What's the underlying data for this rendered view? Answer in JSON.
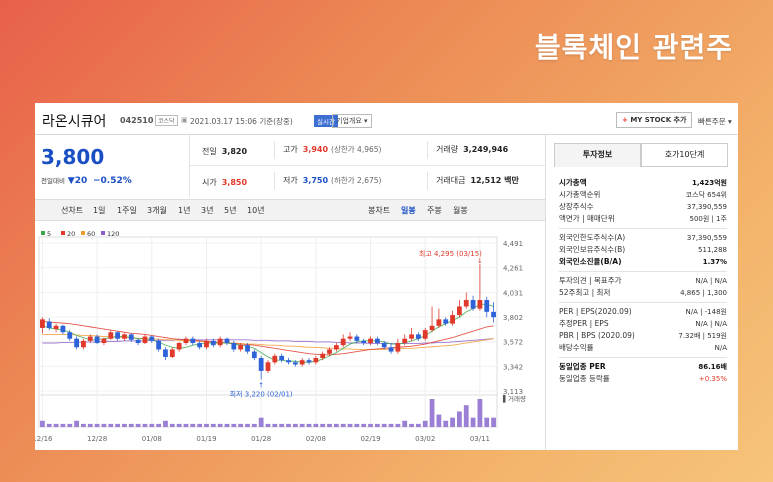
{
  "banner": "블록체인 관련주",
  "stock": {
    "name": "라온시큐어",
    "code": "042510",
    "market": "코스닥",
    "timestamp": "2021.03.17 15:06 기준(장중)",
    "realtime": "실시간",
    "company_info": "기업개요 ▾"
  },
  "actions": {
    "mystock": "MY STOCK 추가",
    "quick_order": "빠른주문 ▾"
  },
  "price": {
    "current": "3,800",
    "change_label": "전일대비",
    "change": "▼20",
    "change_pct": "−0.52%"
  },
  "quotes": {
    "prev_close_label": "전일",
    "prev_close": "3,820",
    "high_label": "고가",
    "high": "3,940",
    "upper_limit": "(상한가 4,965)",
    "volume_label": "거래량",
    "volume": "3,249,946",
    "open_label": "시가",
    "open": "3,850",
    "low_label": "저가",
    "low": "3,750",
    "lower_limit": "(하한가 2,675)",
    "amount_label": "거래대금",
    "amount": "12,512 백만"
  },
  "periods": {
    "items": [
      "선차트",
      "1일",
      "1주일",
      "3개월",
      "1년",
      "3년",
      "5년",
      "10년"
    ],
    "types": [
      "봉차트",
      "일봉",
      "주봉",
      "월봉"
    ],
    "active_type": "일봉"
  },
  "right_tabs": [
    "투자정보",
    "호가10단계"
  ],
  "info": {
    "group1": [
      {
        "k": "시가총액",
        "v": "1,423억원",
        "bold": true
      },
      {
        "k": "시가총액순위",
        "v": "코스닥 654위"
      },
      {
        "k": "상장주식수",
        "v": "37,390,559"
      },
      {
        "k": "액면가 | 매매단위",
        "v": "500원 | 1주"
      }
    ],
    "group2": [
      {
        "k": "외국인한도주식수(A)",
        "v": "37,390,559"
      },
      {
        "k": "외국인보유주식수(B)",
        "v": "511,288"
      },
      {
        "k": "외국인소진율(B/A)",
        "v": "1.37%",
        "bold": true
      }
    ],
    "group3": [
      {
        "k": "투자의견 | 목표주가",
        "v": "N/A | N/A"
      },
      {
        "k": "52주최고 | 최저",
        "v": "4,865 | 1,300"
      }
    ],
    "group4": [
      {
        "k": "PER | EPS(2020.09)",
        "v": "N/A | -148원"
      },
      {
        "k": "추정PER | EPS",
        "v": "N/A | N/A"
      },
      {
        "k": "PBR | BPS (2020.09)",
        "v": "7.32배 | 519원"
      },
      {
        "k": "배당수익률",
        "v": "N/A"
      }
    ],
    "group5": [
      {
        "k": "동일업종 PER",
        "v": "86.16배",
        "bold": true
      },
      {
        "k": "동일업종 등락률",
        "v": "+0.35%",
        "red": true
      }
    ]
  },
  "chart_data": {
    "type": "candlestick",
    "legend": [
      {
        "name": "5",
        "color": "#3aa84a"
      },
      {
        "name": "20",
        "color": "#e0382a"
      },
      {
        "name": "60",
        "color": "#f29b2f"
      },
      {
        "name": "120",
        "color": "#8d5fc8"
      }
    ],
    "y_ticks": [
      "4,491",
      "4,261",
      "4,031",
      "3,802",
      "3,572",
      "3,342",
      "3,113"
    ],
    "ylim": [
      3113,
      4491
    ],
    "x_ticks": [
      "12/16",
      "12/28",
      "01/08",
      "01/19",
      "01/28",
      "02/08",
      "02/19",
      "03/02",
      "03/11"
    ],
    "max_label": "최고 4,295 (03/15)",
    "min_label": "최저 3,220 (02/01)",
    "volume_label": "거래량",
    "candles": [
      [
        3700,
        3780,
        3650,
        3800
      ],
      [
        3760,
        3700,
        3680,
        3790
      ],
      [
        3690,
        3720,
        3660,
        3740
      ],
      [
        3720,
        3660,
        3640,
        3730
      ],
      [
        3660,
        3600,
        3580,
        3680
      ],
      [
        3600,
        3520,
        3500,
        3620
      ],
      [
        3520,
        3580,
        3500,
        3600
      ],
      [
        3580,
        3620,
        3560,
        3640
      ],
      [
        3620,
        3560,
        3550,
        3640
      ],
      [
        3560,
        3600,
        3540,
        3610
      ],
      [
        3600,
        3660,
        3590,
        3680
      ],
      [
        3660,
        3600,
        3580,
        3670
      ],
      [
        3600,
        3640,
        3580,
        3650
      ],
      [
        3640,
        3590,
        3570,
        3650
      ],
      [
        3590,
        3560,
        3540,
        3600
      ],
      [
        3560,
        3620,
        3550,
        3640
      ],
      [
        3620,
        3580,
        3560,
        3630
      ],
      [
        3580,
        3500,
        3480,
        3600
      ],
      [
        3500,
        3430,
        3400,
        3520
      ],
      [
        3430,
        3500,
        3420,
        3520
      ],
      [
        3500,
        3560,
        3480,
        3570
      ],
      [
        3560,
        3600,
        3540,
        3620
      ],
      [
        3600,
        3560,
        3540,
        3620
      ],
      [
        3560,
        3520,
        3500,
        3580
      ],
      [
        3520,
        3580,
        3500,
        3600
      ],
      [
        3580,
        3540,
        3520,
        3600
      ],
      [
        3540,
        3600,
        3520,
        3620
      ],
      [
        3600,
        3560,
        3540,
        3610
      ],
      [
        3560,
        3500,
        3480,
        3580
      ],
      [
        3500,
        3540,
        3480,
        3560
      ],
      [
        3540,
        3480,
        3460,
        3560
      ],
      [
        3480,
        3420,
        3400,
        3500
      ],
      [
        3420,
        3300,
        3220,
        3440
      ],
      [
        3300,
        3380,
        3280,
        3400
      ],
      [
        3380,
        3440,
        3360,
        3460
      ],
      [
        3440,
        3400,
        3380,
        3460
      ],
      [
        3400,
        3380,
        3360,
        3420
      ],
      [
        3380,
        3360,
        3340,
        3400
      ],
      [
        3360,
        3400,
        3340,
        3420
      ],
      [
        3400,
        3380,
        3360,
        3420
      ],
      [
        3380,
        3420,
        3360,
        3440
      ],
      [
        3420,
        3460,
        3400,
        3480
      ],
      [
        3460,
        3500,
        3440,
        3520
      ],
      [
        3500,
        3540,
        3480,
        3560
      ],
      [
        3540,
        3600,
        3520,
        3640
      ],
      [
        3600,
        3620,
        3580,
        3660
      ],
      [
        3620,
        3580,
        3560,
        3640
      ],
      [
        3580,
        3560,
        3540,
        3600
      ],
      [
        3560,
        3600,
        3540,
        3620
      ],
      [
        3600,
        3560,
        3540,
        3620
      ],
      [
        3560,
        3520,
        3500,
        3580
      ],
      [
        3520,
        3480,
        3460,
        3560
      ],
      [
        3480,
        3560,
        3460,
        3600
      ],
      [
        3560,
        3600,
        3540,
        3640
      ],
      [
        3600,
        3640,
        3580,
        3700
      ],
      [
        3640,
        3600,
        3580,
        3660
      ],
      [
        3600,
        3680,
        3580,
        3700
      ],
      [
        3680,
        3720,
        3660,
        3900
      ],
      [
        3720,
        3780,
        3700,
        3880
      ],
      [
        3780,
        3740,
        3720,
        3800
      ],
      [
        3740,
        3820,
        3720,
        3860
      ],
      [
        3820,
        3900,
        3800,
        3960
      ],
      [
        3900,
        3960,
        3880,
        4030
      ],
      [
        3960,
        3880,
        3860,
        4000
      ],
      [
        3880,
        3960,
        3860,
        4295
      ],
      [
        3960,
        3850,
        3800,
        3990
      ],
      [
        3850,
        3800,
        3750,
        3940
      ]
    ],
    "volumes": [
      2,
      1,
      1,
      1,
      1,
      2,
      1,
      1,
      1,
      1,
      1,
      1,
      1,
      1,
      1,
      1,
      1,
      1,
      2,
      1,
      1,
      1,
      1,
      1,
      1,
      1,
      1,
      1,
      1,
      1,
      1,
      1,
      3,
      1,
      1,
      1,
      1,
      1,
      1,
      1,
      1,
      1,
      1,
      1,
      1,
      1,
      1,
      1,
      1,
      1,
      1,
      1,
      1,
      2,
      1,
      1,
      2,
      9,
      4,
      2,
      3,
      5,
      7,
      3,
      9,
      3,
      3
    ],
    "ma5": [
      3720,
      3700,
      3690,
      3680,
      3660,
      3630,
      3610,
      3590,
      3590,
      3600,
      3610,
      3620,
      3620,
      3610,
      3600,
      3600,
      3590,
      3570,
      3540,
      3520,
      3510,
      3520,
      3540,
      3550,
      3560,
      3560,
      3560,
      3560,
      3550,
      3540,
      3530,
      3510,
      3470,
      3430,
      3400,
      3400,
      3390,
      3390,
      3380,
      3380,
      3390,
      3410,
      3440,
      3470,
      3510,
      3550,
      3570,
      3580,
      3580,
      3580,
      3570,
      3550,
      3550,
      3560,
      3580,
      3600,
      3630,
      3670,
      3710,
      3740,
      3770,
      3800,
      3850,
      3880,
      3920,
      3920,
      3900
    ],
    "ma20": [
      3760,
      3755,
      3750,
      3745,
      3740,
      3730,
      3720,
      3710,
      3700,
      3690,
      3680,
      3670,
      3660,
      3650,
      3645,
      3640,
      3630,
      3620,
      3610,
      3600,
      3595,
      3590,
      3585,
      3580,
      3575,
      3570,
      3565,
      3560,
      3555,
      3550,
      3545,
      3540,
      3530,
      3520,
      3510,
      3500,
      3490,
      3480,
      3470,
      3460,
      3455,
      3450,
      3450,
      3455,
      3460,
      3470,
      3480,
      3490,
      3500,
      3505,
      3510,
      3515,
      3520,
      3525,
      3530,
      3540,
      3550,
      3565,
      3580,
      3595,
      3610,
      3630,
      3650,
      3670,
      3690,
      3710,
      3720
    ],
    "ma60": [
      3640,
      3640,
      3640,
      3640,
      3640,
      3635,
      3630,
      3630,
      3625,
      3620,
      3620,
      3615,
      3610,
      3610,
      3605,
      3600,
      3600,
      3595,
      3590,
      3590,
      3585,
      3580,
      3580,
      3575,
      3570,
      3570,
      3565,
      3560,
      3560,
      3555,
      3550,
      3550,
      3545,
      3540,
      3540,
      3535,
      3530,
      3530,
      3525,
      3520,
      3520,
      3515,
      3510,
      3510,
      3505,
      3505,
      3500,
      3500,
      3500,
      3500,
      3500,
      3505,
      3505,
      3510,
      3510,
      3515,
      3520,
      3525,
      3530,
      3535,
      3540,
      3550,
      3560,
      3570,
      3580,
      3590,
      3600
    ],
    "ma120": [
      3560,
      3560,
      3560,
      3565,
      3565,
      3565,
      3570,
      3570,
      3570,
      3575,
      3575,
      3575,
      3580,
      3580,
      3580,
      3580,
      3585,
      3585,
      3585,
      3585,
      3590,
      3590,
      3590,
      3590,
      3590,
      3590,
      3590,
      3590,
      3590,
      3590,
      3590,
      3585,
      3585,
      3585,
      3580,
      3580,
      3580,
      3575,
      3575,
      3575,
      3570,
      3570,
      3570,
      3565,
      3565,
      3560,
      3560,
      3560,
      3555,
      3555,
      3555,
      3555,
      3555,
      3555,
      3555,
      3555,
      3560,
      3560,
      3565,
      3565,
      3570,
      3575,
      3580,
      3585,
      3590,
      3595,
      3600
    ]
  }
}
